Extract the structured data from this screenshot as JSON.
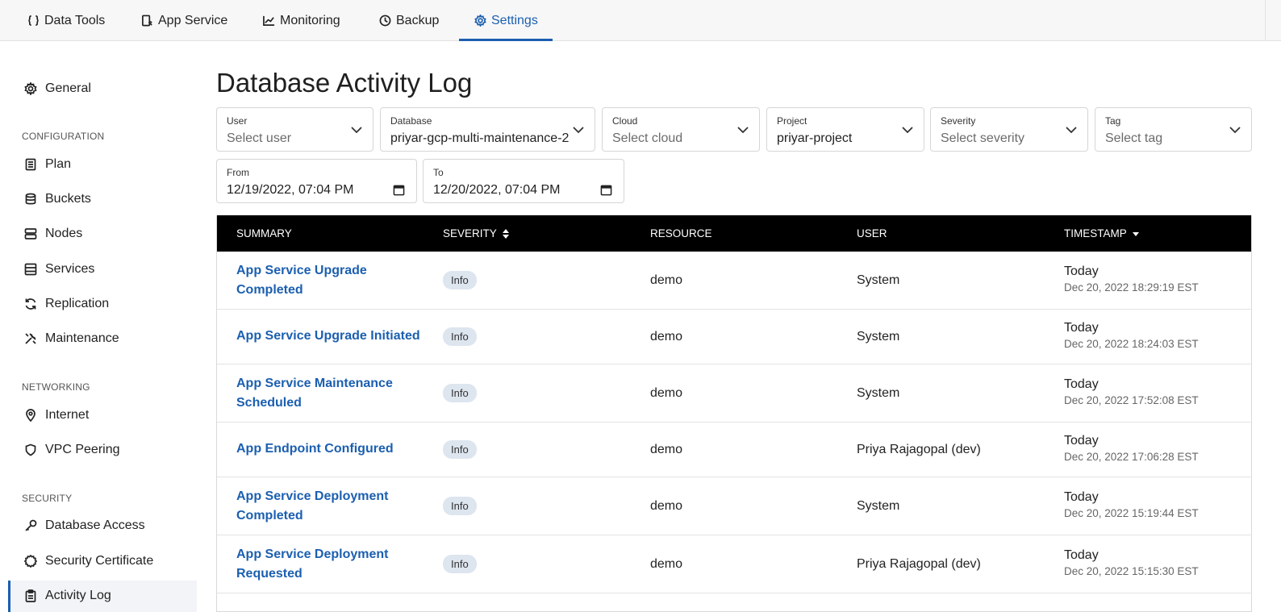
{
  "topnav": {
    "tabs": [
      {
        "label": "Data Tools",
        "icon": "braces-icon"
      },
      {
        "label": "App Service",
        "icon": "app-service-icon"
      },
      {
        "label": "Monitoring",
        "icon": "chart-line-icon"
      },
      {
        "label": "Backup",
        "icon": "clock-icon"
      },
      {
        "label": "Settings",
        "icon": "gear-icon",
        "active": true
      }
    ]
  },
  "sidebar": {
    "general": "General",
    "sections": [
      {
        "title": "CONFIGURATION",
        "items": [
          "Plan",
          "Buckets",
          "Nodes",
          "Services",
          "Replication",
          "Maintenance"
        ]
      },
      {
        "title": "NETWORKING",
        "items": [
          "Internet",
          "VPC Peering"
        ]
      },
      {
        "title": "SECURITY",
        "items": [
          "Database Access",
          "Security Certificate",
          "Activity Log"
        ]
      }
    ],
    "active": "Activity Log"
  },
  "page": {
    "title": "Database Activity Log"
  },
  "filters": {
    "user": {
      "label": "User",
      "placeholder": "Select user"
    },
    "database": {
      "label": "Database",
      "value": "priyar-gcp-multi-maintenance-2"
    },
    "cloud": {
      "label": "Cloud",
      "placeholder": "Select cloud"
    },
    "project": {
      "label": "Project",
      "value": "priyar-project"
    },
    "severity": {
      "label": "Severity",
      "placeholder": "Select severity"
    },
    "tag": {
      "label": "Tag",
      "placeholder": "Select tag"
    },
    "from": {
      "label": "From",
      "value": "12/19/2022, 07:04 PM"
    },
    "to": {
      "label": "To",
      "value": "12/20/2022, 07:04 PM"
    }
  },
  "table": {
    "headers": {
      "summary": "SUMMARY",
      "severity": "SEVERITY",
      "resource": "RESOURCE",
      "user": "USER",
      "timestamp": "TIMESTAMP"
    },
    "rows": [
      {
        "summary": "App Service Upgrade Completed",
        "severity": "Info",
        "resource": "demo",
        "user": "System",
        "day": "Today",
        "timestamp": "Dec 20, 2022 18:29:19 EST"
      },
      {
        "summary": "App Service Upgrade Initiated",
        "severity": "Info",
        "resource": "demo",
        "user": "System",
        "day": "Today",
        "timestamp": "Dec 20, 2022 18:24:03 EST"
      },
      {
        "summary": "App Service Maintenance Scheduled",
        "severity": "Info",
        "resource": "demo",
        "user": "System",
        "day": "Today",
        "timestamp": "Dec 20, 2022 17:52:08 EST"
      },
      {
        "summary": "App Endpoint Configured",
        "severity": "Info",
        "resource": "demo",
        "user": "Priya Rajagopal (dev)",
        "day": "Today",
        "timestamp": "Dec 20, 2022 17:06:28 EST"
      },
      {
        "summary": "App Service Deployment Completed",
        "severity": "Info",
        "resource": "demo",
        "user": "System",
        "day": "Today",
        "timestamp": "Dec 20, 2022 15:19:44 EST"
      },
      {
        "summary": "App Service Deployment Requested",
        "severity": "Info",
        "resource": "demo",
        "user": "Priya Rajagopal (dev)",
        "day": "Today",
        "timestamp": "Dec 20, 2022 15:15:30 EST"
      }
    ]
  }
}
